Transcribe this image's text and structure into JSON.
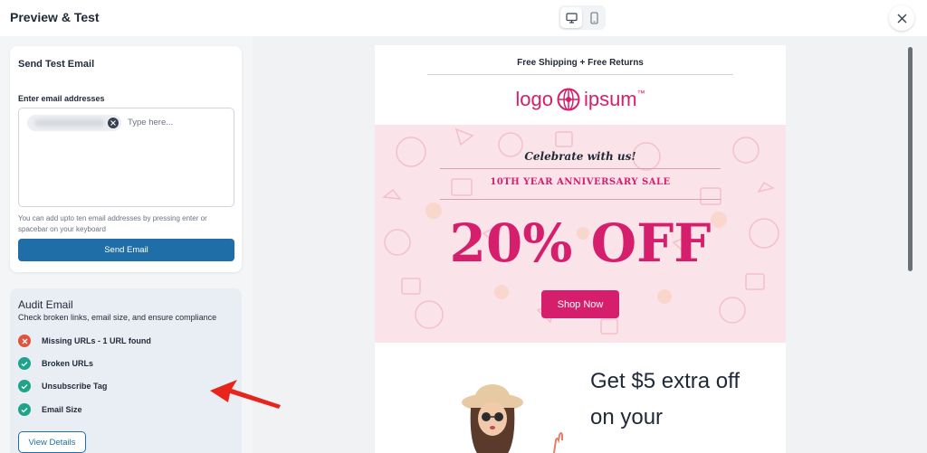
{
  "header": {
    "title": "Preview & Test",
    "active_device": "desktop"
  },
  "send_test": {
    "title": "Send Test Email",
    "field_label": "Enter email addresses",
    "placeholder": "Type here...",
    "hint": "You can add upto ten email addresses by pressing enter or spacebar on your keyboard",
    "button": "Send Email"
  },
  "audit": {
    "title": "Audit Email",
    "subtitle": "Check broken links, email size, and ensure compliance",
    "items": [
      {
        "label": "Missing URLs - 1 URL found",
        "status": "error"
      },
      {
        "label": "Broken URLs",
        "status": "ok"
      },
      {
        "label": "Unsubscribe Tag",
        "status": "ok"
      },
      {
        "label": "Email Size",
        "status": "ok"
      }
    ],
    "button": "View Details"
  },
  "email": {
    "shipping": "Free Shipping + Free Returns",
    "logo_left": "logo",
    "logo_right": "ipsum",
    "logo_tm": "™",
    "celebrate": "Celebrate with us!",
    "anniversary": "10TH YEAR ANNIVERSARY SALE",
    "discount": "20% OFF",
    "cta": "Shop Now",
    "promo_line1": "Get $5 extra off",
    "promo_line2": "on your"
  },
  "colors": {
    "brand_pink": "#d61f6c",
    "primary_blue": "#1f6ea8",
    "error_red": "#e0533f",
    "success_teal": "#1fa38a"
  }
}
